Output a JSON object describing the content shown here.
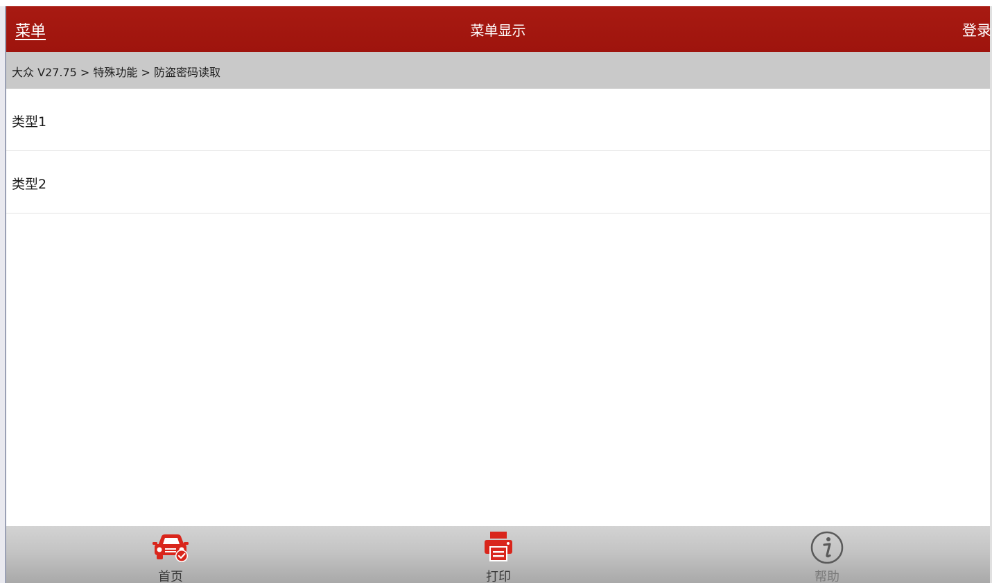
{
  "header": {
    "menu_label": "菜单",
    "title": "菜单显示",
    "login_label": "登录"
  },
  "breadcrumb": {
    "text": "大众 V27.75 > 特殊功能 > 防盗密码读取"
  },
  "list": {
    "items": [
      {
        "label": "类型1"
      },
      {
        "label": "类型2"
      }
    ]
  },
  "footer": {
    "home": {
      "label": "首页",
      "icon": "car-check-icon"
    },
    "print": {
      "label": "打印",
      "icon": "printer-icon"
    },
    "help": {
      "label": "帮助",
      "icon": "info-icon"
    }
  },
  "colors": {
    "header_red": "#a81a12",
    "icon_red": "#d9261c",
    "breadcrumb_gray": "#c9c9c9"
  }
}
